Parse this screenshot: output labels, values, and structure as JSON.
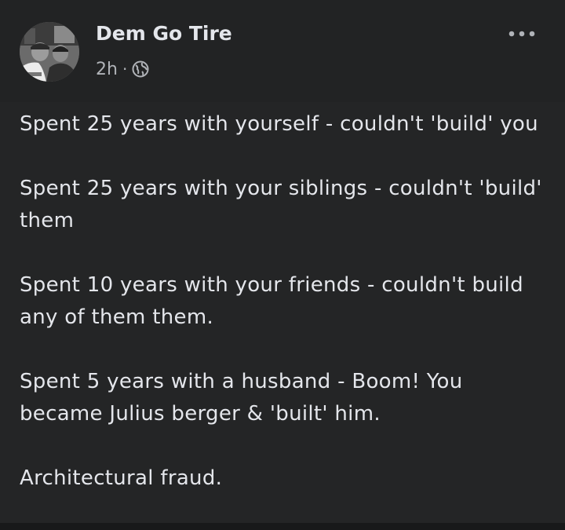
{
  "post": {
    "author": "Dem Go Tire",
    "time": "2h",
    "separator": "·",
    "privacy_icon": "globe-icon",
    "more_icon": "more-options-icon"
  },
  "body": {
    "paragraphs": [
      "Spent 25 years with yourself - couldn't 'build' you",
      "Spent 25 years with your siblings - couldn't 'build' them",
      "Spent 10 years with your friends - couldn't build any of them them.",
      "Spent 5 years with a husband - Boom! You became Julius berger & 'built' him.",
      "Architectural fraud."
    ]
  },
  "colors": {
    "background": "#242526",
    "header_background": "#222324",
    "text": "#e4e6eb",
    "secondary_text": "#b0b3b8"
  }
}
